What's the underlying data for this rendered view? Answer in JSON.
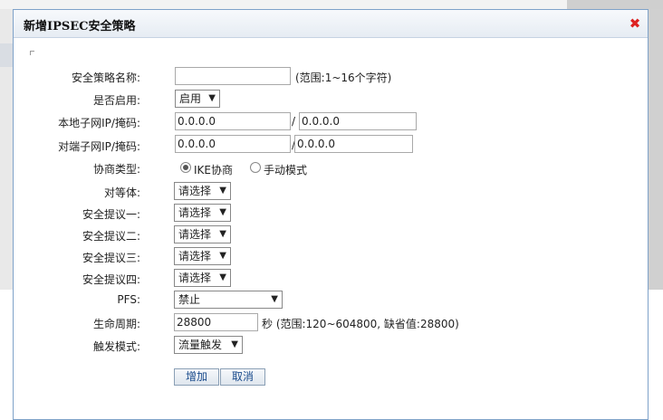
{
  "dialog": {
    "title": "新增IPSEC安全策略",
    "close_icon": "close-icon"
  },
  "form": {
    "policy_name": {
      "label": "安全策略名称:",
      "value": "",
      "hint": "(范围:1~16个字符)"
    },
    "enabled": {
      "label": "是否启用:",
      "value": "启用"
    },
    "local_subnet": {
      "label": "本地子网IP/掩码:",
      "ip": "0.0.0.0",
      "sep": "/",
      "mask": "0.0.0.0"
    },
    "remote_subnet": {
      "label": "对端子网IP/掩码:",
      "ip": "0.0.0.0",
      "sep": "/",
      "mask": "0.0.0.0"
    },
    "negotiation": {
      "label": "协商类型:",
      "options": [
        {
          "label": "IKE协商",
          "checked": true
        },
        {
          "label": "手动模式",
          "checked": false
        }
      ]
    },
    "peer": {
      "label": "对等体:",
      "value": "请选择"
    },
    "proposal1": {
      "label": "安全提议一:",
      "value": "请选择"
    },
    "proposal2": {
      "label": "安全提议二:",
      "value": "请选择"
    },
    "proposal3": {
      "label": "安全提议三:",
      "value": "请选择"
    },
    "proposal4": {
      "label": "安全提议四:",
      "value": "请选择"
    },
    "pfs": {
      "label": "PFS:",
      "value": "禁止"
    },
    "lifetime": {
      "label": "生命周期:",
      "value": "28800",
      "hint": "秒 (范围:120~604800, 缺省值:28800)"
    },
    "trigger": {
      "label": "触发模式:",
      "value": "流量触发"
    }
  },
  "buttons": {
    "add": "增加",
    "cancel": "取消"
  },
  "colors": {
    "close": "#d22222",
    "button_text": "#1a4b8c",
    "dialog_border": "#7fa2c9"
  }
}
